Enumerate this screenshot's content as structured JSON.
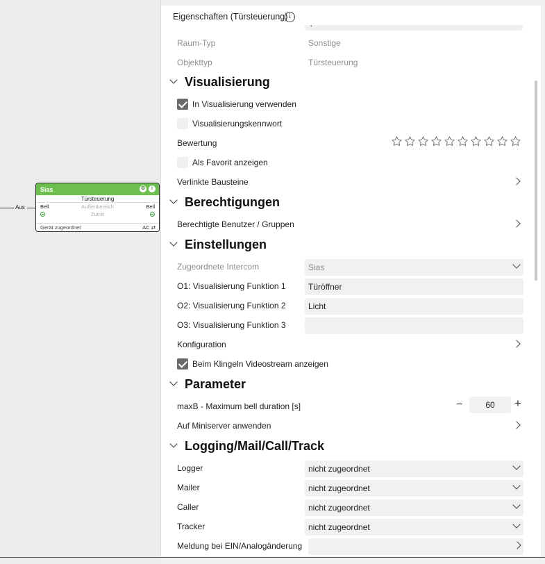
{
  "canvas": {
    "aus_label": "Aus",
    "block": {
      "title": "Sias",
      "icon_gear": "⚙",
      "icon_info": "i",
      "type": "Türsteuerung",
      "row1": {
        "left": "Bell",
        "center": "Außenbereich",
        "right": "Bell"
      },
      "row2": {
        "center": "Zutritt"
      },
      "footer": {
        "left": "Gerät zugeordnet",
        "right": "AC ⇄"
      },
      "header_color": "#6cbf4f"
    }
  },
  "panel": {
    "title": "Eigenschaften (Türsteuerung)",
    "info_icon": "i",
    "top_sliver_text": "•",
    "rows_top": [
      {
        "label": "Raum-Typ",
        "value": "Sonstige"
      },
      {
        "label": "Objekttyp",
        "value": "Türsteuerung"
      }
    ],
    "sections": {
      "visualisierung": "Visualisierung",
      "berechtigungen": "Berechtigungen",
      "einstellungen": "Einstellungen",
      "parameter": "Parameter",
      "logging": "Logging/Mail/Call/Track"
    },
    "visualisierung": {
      "use_in_vis": {
        "label": "In Visualisierung verwenden",
        "checked": true
      },
      "vis_password": {
        "label": "Visualisierungskennwort",
        "checked": false
      },
      "rating_label": "Bewertung",
      "rating_stars": 10,
      "rating_value": 0,
      "favorite": {
        "label": "Als Favorit anzeigen",
        "checked": false
      },
      "linked_blocks": "Verlinkte Bausteine"
    },
    "berechtigungen": {
      "users": "Berechtigte Benutzer / Gruppen"
    },
    "einstellungen": {
      "intercom_label": "Zugeordnete Intercom",
      "intercom_value": "Sias",
      "o1_label": "O1: Visualisierung Funktion 1",
      "o1_value": "Türöffner",
      "o2_label": "O2: Visualisierung Funktion 2",
      "o2_value": "Licht",
      "o3_label": "O3: Visualisierung Funktion 3",
      "o3_value": "",
      "config_label": "Konfiguration",
      "videostream": {
        "label": "Beim Klingeln Videostream anzeigen",
        "checked": true
      }
    },
    "parameter": {
      "maxb_label": "maxB - Maximum bell duration [s]",
      "minus": "−",
      "maxb_value": "60",
      "plus": "+",
      "apply_label": "Auf Miniserver anwenden"
    },
    "logging": {
      "logger_label": "Logger",
      "logger_value": "nicht zugeordnet",
      "mailer_label": "Mailer",
      "mailer_value": "nicht zugeordnet",
      "caller_label": "Caller",
      "caller_value": "nicht zugeordnet",
      "tracker_label": "Tracker",
      "tracker_value": "nicht zugeordnet",
      "meldung_label": "Meldung bei EIN/Analogänderung",
      "meldung_value": ""
    }
  }
}
